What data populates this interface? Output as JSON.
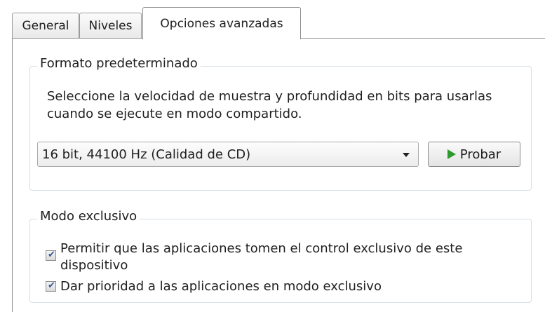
{
  "tabs": [
    {
      "label": "General"
    },
    {
      "label": "Niveles"
    },
    {
      "label": "Opciones avanzadas"
    }
  ],
  "format_group": {
    "title": "Formato predeterminado",
    "description": "Seleccione la velocidad de muestra y profundidad en bits para usarlas cuando se ejecute en modo compartido.",
    "select": {
      "value": "16 bit, 44100 Hz (Calidad de CD)"
    },
    "test_button": {
      "label": "Probar",
      "icon": "play-icon"
    }
  },
  "exclusive_group": {
    "title": "Modo exclusivo",
    "options": [
      {
        "label": "Permitir que las aplicaciones tomen el control exclusivo de este dispositivo",
        "checked": true
      },
      {
        "label": "Dar prioridad a las aplicaciones en modo exclusivo",
        "checked": true
      }
    ]
  },
  "colors": {
    "play_icon": "#2c9a2c",
    "checkmark": "#3a5a9a",
    "group_border": "#d5dfe5"
  }
}
